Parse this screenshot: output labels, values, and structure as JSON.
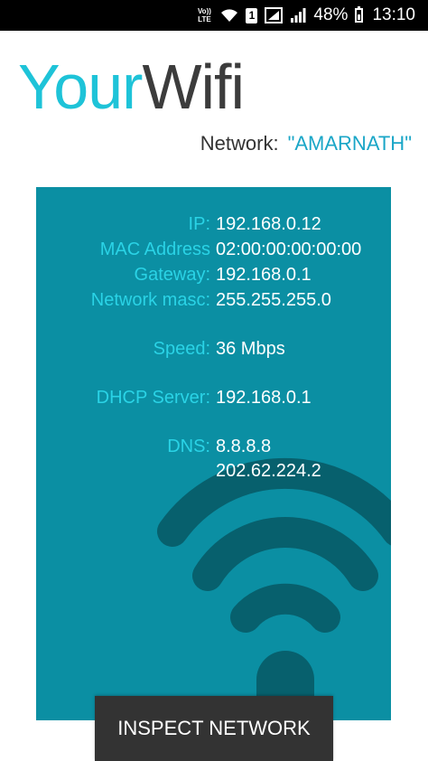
{
  "status_bar": {
    "volte_label": "Vo)) LTE",
    "sim_label": "1",
    "battery_percent": "48%",
    "time": "13:10",
    "icons": [
      "volte-icon",
      "wifi-icon",
      "sim-icon",
      "mobile-data-icon",
      "signal-icon",
      "battery-icon"
    ]
  },
  "app": {
    "title_part1": "Your",
    "title_part2": "Wifi",
    "network_label": "Network:",
    "network_value": "\"AMARNATH\""
  },
  "info": {
    "ip_label": "IP:",
    "ip_value": "192.168.0.12",
    "mac_label": "MAC Address",
    "mac_value": "02:00:00:00:00:00",
    "gateway_label": "Gateway:",
    "gateway_value": "192.168.0.1",
    "mask_label": "Network masc:",
    "mask_value": "255.255.255.0",
    "speed_label": "Speed:",
    "speed_value": "36 Mbps",
    "dhcp_label": "DHCP Server:",
    "dhcp_value": "192.168.0.1",
    "dns_label": "DNS:",
    "dns_value_1": "8.8.8.8",
    "dns_value_2": "202.62.224.2"
  },
  "actions": {
    "inspect_label": "INSPECT NETWORK"
  },
  "colors": {
    "accent_cyan": "#1ec3d8",
    "panel_teal": "#0b8fa3",
    "wifi_art": "#07606d",
    "label_cyan": "#2ad3e6",
    "button_dark": "#333333"
  }
}
